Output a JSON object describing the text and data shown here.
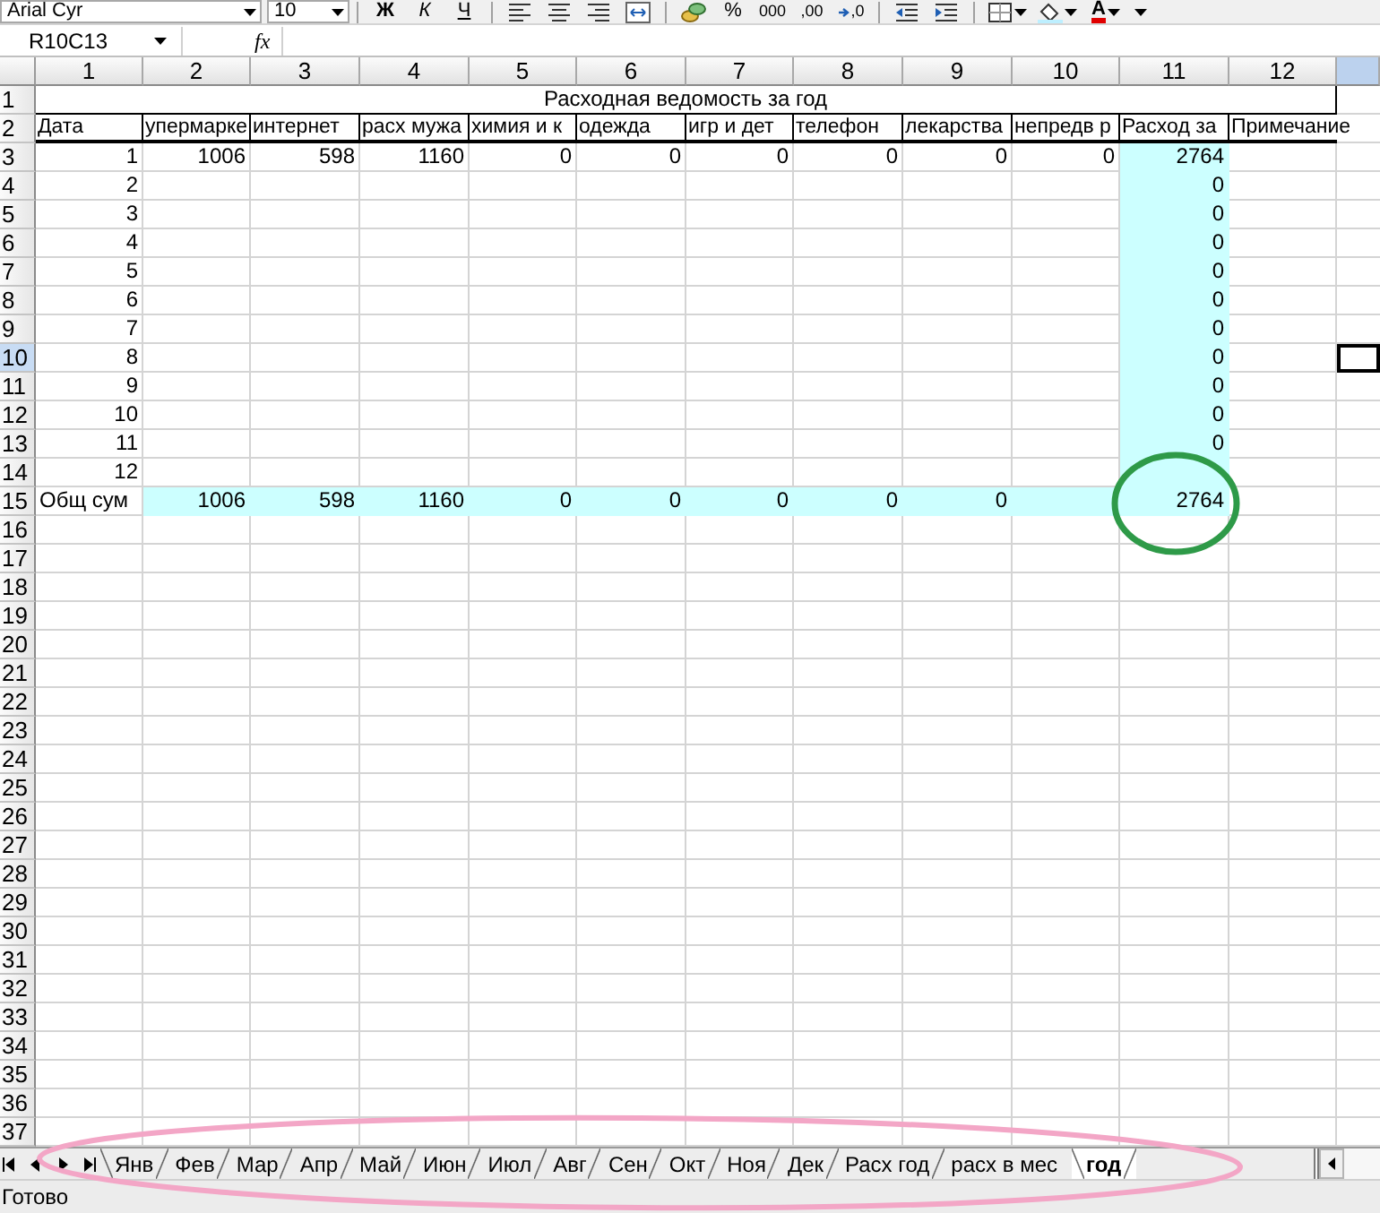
{
  "toolbar": {
    "font_name": "Arial Cyr",
    "font_size": "10",
    "buttons": [
      {
        "kind": "separator"
      },
      {
        "kind": "bold",
        "label": "Ж"
      },
      {
        "kind": "italic",
        "label": "К"
      },
      {
        "kind": "underline",
        "label": "Ч"
      },
      {
        "kind": "separator"
      },
      {
        "kind": "align-left"
      },
      {
        "kind": "align-center"
      },
      {
        "kind": "align-right"
      },
      {
        "kind": "merge"
      },
      {
        "kind": "separator"
      },
      {
        "kind": "currency"
      },
      {
        "kind": "percent",
        "label": "%"
      },
      {
        "kind": "thousands",
        "label": "000"
      },
      {
        "kind": "increase-decimal",
        "label": ",00"
      },
      {
        "kind": "decrease-decimal",
        "label": ",0"
      },
      {
        "kind": "separator"
      },
      {
        "kind": "outdent"
      },
      {
        "kind": "indent"
      },
      {
        "kind": "separator"
      },
      {
        "kind": "borders"
      },
      {
        "kind": "fill-color"
      },
      {
        "kind": "font-color",
        "label": "A"
      },
      {
        "kind": "options"
      }
    ]
  },
  "formula_bar": {
    "name_box": "R10C13",
    "function_label": "fx"
  },
  "sheet": {
    "column_headers": [
      {
        "label": "1",
        "selected": false
      },
      {
        "label": "2",
        "selected": false
      },
      {
        "label": "3",
        "selected": false
      },
      {
        "label": "4",
        "selected": false
      },
      {
        "label": "5",
        "selected": false
      },
      {
        "label": "6",
        "selected": false
      },
      {
        "label": "7",
        "selected": false
      },
      {
        "label": "8",
        "selected": false
      },
      {
        "label": "9",
        "selected": false
      },
      {
        "label": "10",
        "selected": false
      },
      {
        "label": "11",
        "selected": false
      },
      {
        "label": "12",
        "selected": false
      },
      {
        "selected": true
      }
    ],
    "rows": [
      {
        "header": "1",
        "selected": false,
        "kind": "title",
        "title": "Расходная ведомость за год"
      },
      {
        "header": "2",
        "selected": false,
        "kind": "header",
        "cells": [
          "Дата",
          "упермарке",
          "интернет",
          "расх мужа",
          "химия и к",
          "одежда",
          "игр и дет",
          "телефон",
          "лекарства",
          "непредв р",
          "Расход за",
          "Примечание"
        ]
      },
      {
        "header": "3",
        "selected": false,
        "kind": "data",
        "cells": [
          {
            "kind": "number",
            "value": "1",
            "highlighted": false
          },
          {
            "kind": "number",
            "value": "1006",
            "highlighted": false
          },
          {
            "kind": "number",
            "value": "598",
            "highlighted": false
          },
          {
            "kind": "number",
            "value": "1160",
            "highlighted": false
          },
          {
            "kind": "number",
            "value": "0",
            "highlighted": false
          },
          {
            "kind": "number",
            "value": "0",
            "highlighted": false
          },
          {
            "kind": "number",
            "value": "0",
            "highlighted": false
          },
          {
            "kind": "number",
            "value": "0",
            "highlighted": false
          },
          {
            "kind": "number",
            "value": "0",
            "highlighted": false
          },
          {
            "kind": "number",
            "value": "0",
            "highlighted": false
          },
          {
            "kind": "number",
            "value": "2764",
            "highlighted": true
          },
          {
            "kind": "empty",
            "highlighted": false
          }
        ]
      },
      {
        "header": "4",
        "selected": false,
        "kind": "data",
        "cells": [
          {
            "kind": "number",
            "value": "2",
            "highlighted": false
          },
          {
            "kind": "empty",
            "highlighted": false
          },
          {
            "kind": "empty",
            "highlighted": false
          },
          {
            "kind": "empty",
            "highlighted": false
          },
          {
            "kind": "empty",
            "highlighted": false
          },
          {
            "kind": "empty",
            "highlighted": false
          },
          {
            "kind": "empty",
            "highlighted": false
          },
          {
            "kind": "empty",
            "highlighted": false
          },
          {
            "kind": "empty",
            "highlighted": false
          },
          {
            "kind": "empty",
            "highlighted": false
          },
          {
            "kind": "number",
            "value": "0",
            "highlighted": true
          },
          {
            "kind": "empty",
            "highlighted": false
          }
        ]
      },
      {
        "header": "5",
        "selected": false,
        "kind": "data",
        "cells": [
          {
            "kind": "number",
            "value": "3",
            "highlighted": false
          },
          {
            "kind": "empty",
            "highlighted": false
          },
          {
            "kind": "empty",
            "highlighted": false
          },
          {
            "kind": "empty",
            "highlighted": false
          },
          {
            "kind": "empty",
            "highlighted": false
          },
          {
            "kind": "empty",
            "highlighted": false
          },
          {
            "kind": "empty",
            "highlighted": false
          },
          {
            "kind": "empty",
            "highlighted": false
          },
          {
            "kind": "empty",
            "highlighted": false
          },
          {
            "kind": "empty",
            "highlighted": false
          },
          {
            "kind": "number",
            "value": "0",
            "highlighted": true
          },
          {
            "kind": "empty",
            "highlighted": false
          }
        ]
      },
      {
        "header": "6",
        "selected": false,
        "kind": "data",
        "cells": [
          {
            "kind": "number",
            "value": "4",
            "highlighted": false
          },
          {
            "kind": "empty",
            "highlighted": false
          },
          {
            "kind": "empty",
            "highlighted": false
          },
          {
            "kind": "empty",
            "highlighted": false
          },
          {
            "kind": "empty",
            "highlighted": false
          },
          {
            "kind": "empty",
            "highlighted": false
          },
          {
            "kind": "empty",
            "highlighted": false
          },
          {
            "kind": "empty",
            "highlighted": false
          },
          {
            "kind": "empty",
            "highlighted": false
          },
          {
            "kind": "empty",
            "highlighted": false
          },
          {
            "kind": "number",
            "value": "0",
            "highlighted": true
          },
          {
            "kind": "empty",
            "highlighted": false
          }
        ]
      },
      {
        "header": "7",
        "selected": false,
        "kind": "data",
        "cells": [
          {
            "kind": "number",
            "value": "5",
            "highlighted": false
          },
          {
            "kind": "empty",
            "highlighted": false
          },
          {
            "kind": "empty",
            "highlighted": false
          },
          {
            "kind": "empty",
            "highlighted": false
          },
          {
            "kind": "empty",
            "highlighted": false
          },
          {
            "kind": "empty",
            "highlighted": false
          },
          {
            "kind": "empty",
            "highlighted": false
          },
          {
            "kind": "empty",
            "highlighted": false
          },
          {
            "kind": "empty",
            "highlighted": false
          },
          {
            "kind": "empty",
            "highlighted": false
          },
          {
            "kind": "number",
            "value": "0",
            "highlighted": true
          },
          {
            "kind": "empty",
            "highlighted": false
          }
        ]
      },
      {
        "header": "8",
        "selected": false,
        "kind": "data",
        "cells": [
          {
            "kind": "number",
            "value": "6",
            "highlighted": false
          },
          {
            "kind": "empty",
            "highlighted": false
          },
          {
            "kind": "empty",
            "highlighted": false
          },
          {
            "kind": "empty",
            "highlighted": false
          },
          {
            "kind": "empty",
            "highlighted": false
          },
          {
            "kind": "empty",
            "highlighted": false
          },
          {
            "kind": "empty",
            "highlighted": false
          },
          {
            "kind": "empty",
            "highlighted": false
          },
          {
            "kind": "empty",
            "highlighted": false
          },
          {
            "kind": "empty",
            "highlighted": false
          },
          {
            "kind": "number",
            "value": "0",
            "highlighted": true
          },
          {
            "kind": "empty",
            "highlighted": false
          }
        ]
      },
      {
        "header": "9",
        "selected": false,
        "kind": "data",
        "cells": [
          {
            "kind": "number",
            "value": "7",
            "highlighted": false
          },
          {
            "kind": "empty",
            "highlighted": false
          },
          {
            "kind": "empty",
            "highlighted": false
          },
          {
            "kind": "empty",
            "highlighted": false
          },
          {
            "kind": "empty",
            "highlighted": false
          },
          {
            "kind": "empty",
            "highlighted": false
          },
          {
            "kind": "empty",
            "highlighted": false
          },
          {
            "kind": "empty",
            "highlighted": false
          },
          {
            "kind": "empty",
            "highlighted": false
          },
          {
            "kind": "empty",
            "highlighted": false
          },
          {
            "kind": "number",
            "value": "0",
            "highlighted": true
          },
          {
            "kind": "empty",
            "highlighted": false
          }
        ]
      },
      {
        "header": "10",
        "selected": true,
        "kind": "data",
        "cells": [
          {
            "kind": "number",
            "value": "8",
            "highlighted": false
          },
          {
            "kind": "empty",
            "highlighted": false
          },
          {
            "kind": "empty",
            "highlighted": false
          },
          {
            "kind": "empty",
            "highlighted": false
          },
          {
            "kind": "empty",
            "highlighted": false
          },
          {
            "kind": "empty",
            "highlighted": false
          },
          {
            "kind": "empty",
            "highlighted": false
          },
          {
            "kind": "empty",
            "highlighted": false
          },
          {
            "kind": "empty",
            "highlighted": false
          },
          {
            "kind": "empty",
            "highlighted": false
          },
          {
            "kind": "number",
            "value": "0",
            "highlighted": true
          },
          {
            "kind": "empty",
            "highlighted": false
          }
        ]
      },
      {
        "header": "11",
        "selected": false,
        "kind": "data",
        "cells": [
          {
            "kind": "number",
            "value": "9",
            "highlighted": false
          },
          {
            "kind": "empty",
            "highlighted": false
          },
          {
            "kind": "empty",
            "highlighted": false
          },
          {
            "kind": "empty",
            "highlighted": false
          },
          {
            "kind": "empty",
            "highlighted": false
          },
          {
            "kind": "empty",
            "highlighted": false
          },
          {
            "kind": "empty",
            "highlighted": false
          },
          {
            "kind": "empty",
            "highlighted": false
          },
          {
            "kind": "empty",
            "highlighted": false
          },
          {
            "kind": "empty",
            "highlighted": false
          },
          {
            "kind": "number",
            "value": "0",
            "highlighted": true
          },
          {
            "kind": "empty",
            "highlighted": false
          }
        ]
      },
      {
        "header": "12",
        "selected": false,
        "kind": "data",
        "cells": [
          {
            "kind": "number",
            "value": "10",
            "highlighted": false
          },
          {
            "kind": "empty",
            "highlighted": false
          },
          {
            "kind": "empty",
            "highlighted": false
          },
          {
            "kind": "empty",
            "highlighted": false
          },
          {
            "kind": "empty",
            "highlighted": false
          },
          {
            "kind": "empty",
            "highlighted": false
          },
          {
            "kind": "empty",
            "highlighted": false
          },
          {
            "kind": "empty",
            "highlighted": false
          },
          {
            "kind": "empty",
            "highlighted": false
          },
          {
            "kind": "empty",
            "highlighted": false
          },
          {
            "kind": "number",
            "value": "0",
            "highlighted": true
          },
          {
            "kind": "empty",
            "highlighted": false
          }
        ]
      },
      {
        "header": "13",
        "selected": false,
        "kind": "data",
        "cells": [
          {
            "kind": "number",
            "value": "11",
            "highlighted": false
          },
          {
            "kind": "empty",
            "highlighted": false
          },
          {
            "kind": "empty",
            "highlighted": false
          },
          {
            "kind": "empty",
            "highlighted": false
          },
          {
            "kind": "empty",
            "highlighted": false
          },
          {
            "kind": "empty",
            "highlighted": false
          },
          {
            "kind": "empty",
            "highlighted": false
          },
          {
            "kind": "empty",
            "highlighted": false
          },
          {
            "kind": "empty",
            "highlighted": false
          },
          {
            "kind": "empty",
            "highlighted": false
          },
          {
            "kind": "number",
            "value": "0",
            "highlighted": true
          },
          {
            "kind": "empty",
            "highlighted": false
          }
        ]
      },
      {
        "header": "14",
        "selected": false,
        "kind": "data",
        "cells": [
          {
            "kind": "number",
            "value": "12",
            "highlighted": false
          },
          {
            "kind": "empty",
            "highlighted": false
          },
          {
            "kind": "empty",
            "highlighted": false
          },
          {
            "kind": "empty",
            "highlighted": false
          },
          {
            "kind": "empty",
            "highlighted": false
          },
          {
            "kind": "empty",
            "highlighted": false
          },
          {
            "kind": "empty",
            "highlighted": false
          },
          {
            "kind": "empty",
            "highlighted": false
          },
          {
            "kind": "empty",
            "highlighted": false
          },
          {
            "kind": "empty",
            "highlighted": false
          },
          {
            "kind": "empty",
            "highlighted": true
          },
          {
            "kind": "empty",
            "highlighted": false
          }
        ]
      },
      {
        "header": "15",
        "selected": false,
        "kind": "data",
        "cells": [
          {
            "kind": "text",
            "value": "Общ сум",
            "highlighted": false
          },
          {
            "kind": "number",
            "value": "1006",
            "highlighted": true
          },
          {
            "kind": "number",
            "value": "598",
            "highlighted": true
          },
          {
            "kind": "number",
            "value": "1160",
            "highlighted": true
          },
          {
            "kind": "number",
            "value": "0",
            "highlighted": true
          },
          {
            "kind": "number",
            "value": "0",
            "highlighted": true
          },
          {
            "kind": "number",
            "value": "0",
            "highlighted": true
          },
          {
            "kind": "number",
            "value": "0",
            "highlighted": true
          },
          {
            "kind": "number",
            "value": "0",
            "highlighted": true
          },
          {
            "kind": "empty",
            "highlighted": true
          },
          {
            "kind": "number",
            "value": "2764",
            "highlighted": true
          },
          {
            "kind": "empty",
            "highlighted": false
          }
        ]
      },
      {
        "header": "16",
        "selected": false,
        "kind": "empty"
      },
      {
        "header": "17",
        "selected": false,
        "kind": "empty"
      },
      {
        "header": "18",
        "selected": false,
        "kind": "empty"
      },
      {
        "header": "19",
        "selected": false,
        "kind": "empty"
      },
      {
        "header": "20",
        "selected": false,
        "kind": "empty"
      },
      {
        "header": "21",
        "selected": false,
        "kind": "empty"
      },
      {
        "header": "22",
        "selected": false,
        "kind": "empty"
      },
      {
        "header": "23",
        "selected": false,
        "kind": "empty"
      },
      {
        "header": "24",
        "selected": false,
        "kind": "empty"
      },
      {
        "header": "25",
        "selected": false,
        "kind": "empty"
      },
      {
        "header": "26",
        "selected": false,
        "kind": "empty"
      },
      {
        "header": "27",
        "selected": false,
        "kind": "empty"
      },
      {
        "header": "28",
        "selected": false,
        "kind": "empty"
      },
      {
        "header": "29",
        "selected": false,
        "kind": "empty"
      },
      {
        "header": "30",
        "selected": false,
        "kind": "empty"
      },
      {
        "header": "31",
        "selected": false,
        "kind": "empty"
      },
      {
        "header": "32",
        "selected": false,
        "kind": "empty"
      },
      {
        "header": "33",
        "selected": false,
        "kind": "empty"
      },
      {
        "header": "34",
        "selected": false,
        "kind": "empty"
      },
      {
        "header": "35",
        "selected": false,
        "kind": "empty"
      },
      {
        "header": "36",
        "selected": false,
        "kind": "empty"
      },
      {
        "header": "37",
        "selected": false,
        "kind": "empty"
      }
    ]
  },
  "sheet_tabs": [
    {
      "label": "Янв",
      "selected": false
    },
    {
      "label": "Фев",
      "selected": false
    },
    {
      "label": "Мар",
      "selected": false
    },
    {
      "label": "Апр",
      "selected": false
    },
    {
      "label": "Май",
      "selected": false
    },
    {
      "label": "Июн",
      "selected": false
    },
    {
      "label": "Июл",
      "selected": false
    },
    {
      "label": "Авг",
      "selected": false
    },
    {
      "label": "Сен",
      "selected": false
    },
    {
      "label": "Окт",
      "selected": false
    },
    {
      "label": "Ноя",
      "selected": false
    },
    {
      "label": "Дек",
      "selected": false
    },
    {
      "label": "Расх год",
      "selected": false
    },
    {
      "label": "расх в мес",
      "selected": false
    },
    {
      "label": "год",
      "selected": true
    }
  ],
  "status_bar": {
    "text": "Готово"
  },
  "annotations": [
    {
      "kind": "circle",
      "color": "#2e9a48"
    },
    {
      "kind": "ellipse",
      "color": "#f3a6c6"
    }
  ]
}
